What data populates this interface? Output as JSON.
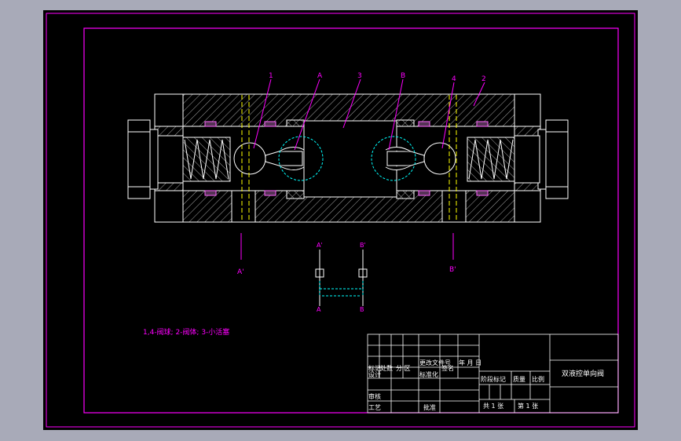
{
  "drawing": {
    "part_labels": {
      "p1": "1",
      "pA": "A",
      "p3": "3",
      "pB": "B",
      "p4": "4",
      "p2": "2"
    },
    "section_labels": {
      "a_prime": "A'",
      "b_prime": "B'"
    },
    "schematic": {
      "a_top": "A'",
      "b_top": "B'",
      "a_bottom": "A",
      "b_bottom": "B"
    },
    "note": "1,4-阀球; 2-阀体; 3-小活塞"
  },
  "title_block": {
    "biaoji": "标记",
    "chushu": "处数",
    "fenqu": "分 区",
    "gengai": "更改文件号",
    "qianming": "签名",
    "nianyueri": "年 月 日",
    "sheji": "设计",
    "biaozhunhua": "标准化",
    "jieduan": "阶段标记",
    "zhongliang": "质量",
    "bili": "比例",
    "shenhe": "审核",
    "gongyi": "工艺",
    "pizhun": "批准",
    "gong": "共 1 张",
    "di": "第 1 张",
    "title": "双液控单向阀"
  },
  "colors": {
    "frame": "#ff00ff",
    "outline": "#ffffff",
    "label": "#ff00ff",
    "centerline": "#ffff00",
    "hidden": "#00ffff"
  }
}
